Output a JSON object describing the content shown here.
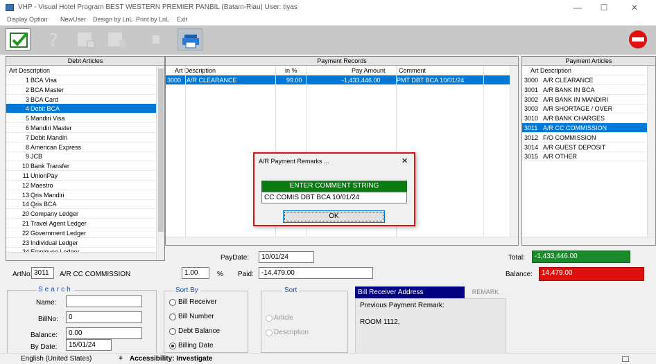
{
  "window": {
    "title": "VHP - Visual Hotel Program     BEST WESTERN PREMIER PANBIL (Batam-Riau) User: tiyas",
    "minimize": "—",
    "maximize": "☐",
    "close": "✕"
  },
  "menu": [
    "Display Option",
    "NewUser",
    "Design by LnL",
    "Print by LnL",
    "Exit"
  ],
  "debt_articles": {
    "header": "Debt Articles",
    "col_header": "Art Description",
    "items": [
      {
        "no": "1",
        "desc": "BCA Visa"
      },
      {
        "no": "2",
        "desc": "BCA Master"
      },
      {
        "no": "3",
        "desc": "BCA Card"
      },
      {
        "no": "4",
        "desc": "Debit BCA"
      },
      {
        "no": "5",
        "desc": "Mandiri Visa"
      },
      {
        "no": "6",
        "desc": "Mandiri Master"
      },
      {
        "no": "7",
        "desc": "Debit Mandiri"
      },
      {
        "no": "8",
        "desc": "American Express"
      },
      {
        "no": "9",
        "desc": "JCB"
      },
      {
        "no": "10",
        "desc": "Bank Transfer"
      },
      {
        "no": "11",
        "desc": "UnionPay"
      },
      {
        "no": "12",
        "desc": "Maestro"
      },
      {
        "no": "13",
        "desc": "Qris Mandiri"
      },
      {
        "no": "14",
        "desc": "Qris BCA"
      },
      {
        "no": "20",
        "desc": "Company Ledger"
      },
      {
        "no": "21",
        "desc": "Travel Agent Ledger"
      },
      {
        "no": "22",
        "desc": "Government Ledger"
      },
      {
        "no": "23",
        "desc": "Individual Ledger"
      },
      {
        "no": "24",
        "desc": "Employee Ledger"
      }
    ]
  },
  "payment_records": {
    "header": "Payment Records",
    "columns": [
      "Art Description",
      "in %",
      "Pay Amount",
      "Comment"
    ],
    "rows": [
      {
        "art": "3000",
        "desc": "A/R CLEARANCE",
        "pct": "99.00",
        "amount": "-1,433,446.00",
        "comment": "PMT DBT BCA 10/01/24"
      }
    ]
  },
  "payment_articles": {
    "header": "Payment Articles",
    "col_header": "Art Description",
    "items": [
      {
        "no": "3000",
        "desc": "A/R CLEARANCE"
      },
      {
        "no": "3001",
        "desc": "A/R BANK IN BCA"
      },
      {
        "no": "3002",
        "desc": "A/R BANK IN MANDIRI"
      },
      {
        "no": "3003",
        "desc": "A/R SHORTAGE / OVER"
      },
      {
        "no": "3010",
        "desc": "A/R BANK CHARGES"
      },
      {
        "no": "3011",
        "desc": "A/R CC COMMISSION"
      },
      {
        "no": "3012",
        "desc": "F/O COMMISSION"
      },
      {
        "no": "3014",
        "desc": "A/R GUEST DEPOSIT"
      },
      {
        "no": "3015",
        "desc": "A/R OTHER"
      }
    ]
  },
  "form": {
    "paydate_label": "PayDate:",
    "paydate": "10/01/24",
    "total_label": "Total:",
    "total": "-1,433,446.00",
    "artno_label": "ArtNo:",
    "artno": "3011",
    "artname": "A/R CC COMMISSION",
    "pct": "1.00",
    "pct_label": "%",
    "paid_label": "Paid:",
    "paid": "-14,479.00",
    "balance_label": "Balance:",
    "balance": "14,479.00"
  },
  "search": {
    "title": "Search",
    "name_label": "Name:",
    "name": "",
    "billno_label": "BillNo:",
    "billno": "0",
    "balance_label": "Balance:",
    "balance": "0.00",
    "bydate_label": "By Date:",
    "bydate": "15/01/24"
  },
  "sort_by": {
    "title": "Sort By",
    "options": [
      "Bill Receiver",
      "Bill Number",
      "Debt Balance",
      "Billing Date"
    ],
    "selected": 3
  },
  "sort": {
    "title": "Sort",
    "options": [
      "Article",
      "Description"
    ]
  },
  "bill_receiver": {
    "tab1": "Bill Receiver Address",
    "tab2": "REMARK",
    "remark_label": "Previous Payment Remark:",
    "remark": "ROOM 1112,"
  },
  "dialog": {
    "title": "A/R Payment Remarks ...",
    "close": "✕",
    "header": "ENTER COMMENT STRING",
    "value": "CC COMIS DBT BCA 10/01/24",
    "ok": "OK"
  },
  "statusbar": {
    "language": "English (United States)",
    "accessibility": "Accessibility: Investigate"
  },
  "colors": {
    "selection": "#0078d7",
    "total_bg": "#1a8a2a",
    "balance_bg": "#e01010",
    "dialog_header": "#0b7a13",
    "bill_tab": "#000080"
  }
}
